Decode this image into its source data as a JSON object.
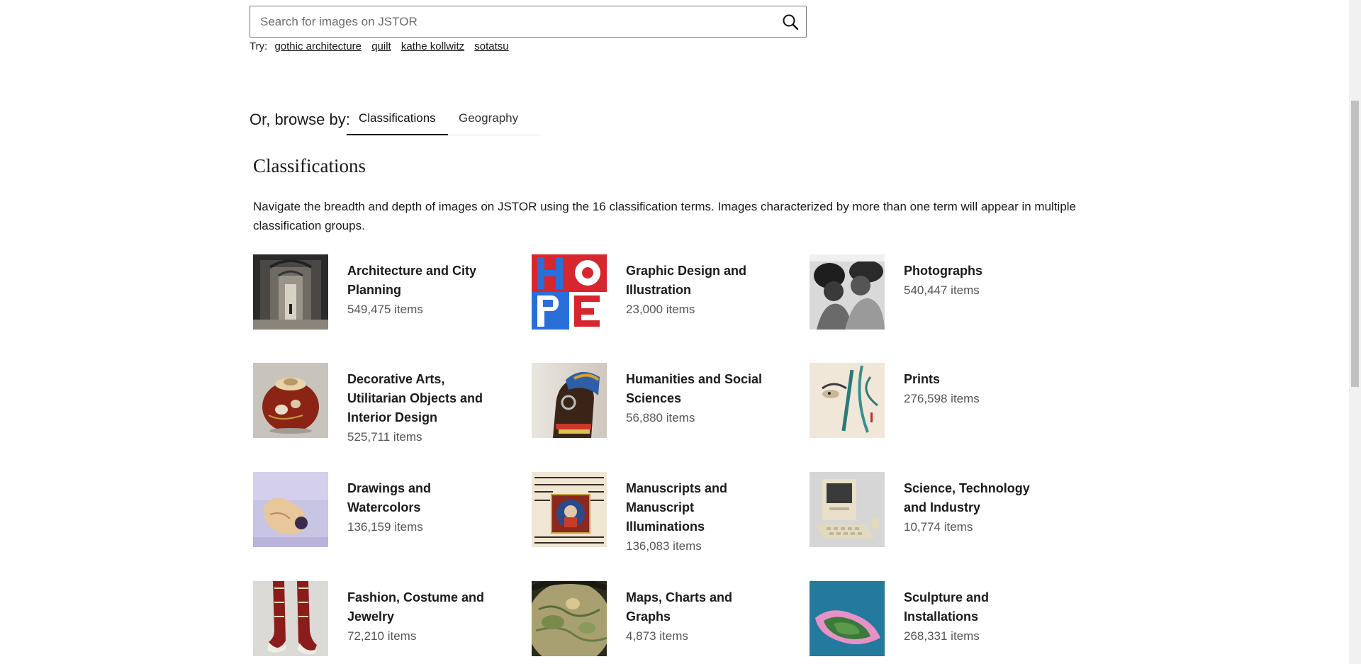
{
  "search": {
    "placeholder": "Search for images on JSTOR",
    "value": "",
    "try_label": "Try:",
    "suggestions": [
      "gothic architecture",
      "quilt",
      "kathe kollwitz",
      "sotatsu"
    ]
  },
  "browse": {
    "label": "Or, browse by:",
    "tabs": [
      {
        "label": "Classifications",
        "active": true
      },
      {
        "label": "Geography",
        "active": false
      }
    ]
  },
  "section": {
    "title": "Classifications",
    "description": "Navigate the breadth and depth of images on JSTOR using the 16 classification terms. Images characterized by more than one term will appear in multiple classification groups."
  },
  "classifications": [
    {
      "title": "Architecture and City Planning",
      "count": "549,475 items"
    },
    {
      "title": "Graphic Design and Illustration",
      "count": "23,000 items"
    },
    {
      "title": "Photographs",
      "count": "540,447 items"
    },
    {
      "title": "Decorative Arts, Utilitarian Objects and Interior Design",
      "count": "525,711 items"
    },
    {
      "title": "Humanities and Social Sciences",
      "count": "56,880 items"
    },
    {
      "title": "Prints",
      "count": "276,598 items"
    },
    {
      "title": "Drawings and Watercolors",
      "count": "136,159 items"
    },
    {
      "title": "Manuscripts and Manuscript Illuminations",
      "count": "136,083 items"
    },
    {
      "title": "Science, Technology and Industry",
      "count": "10,774 items"
    },
    {
      "title": "Fashion, Costume and Jewelry",
      "count": "72,210 items"
    },
    {
      "title": "Maps, Charts and Graphs",
      "count": "4,873 items"
    },
    {
      "title": "Sculpture and Installations",
      "count": "268,331 items"
    }
  ]
}
